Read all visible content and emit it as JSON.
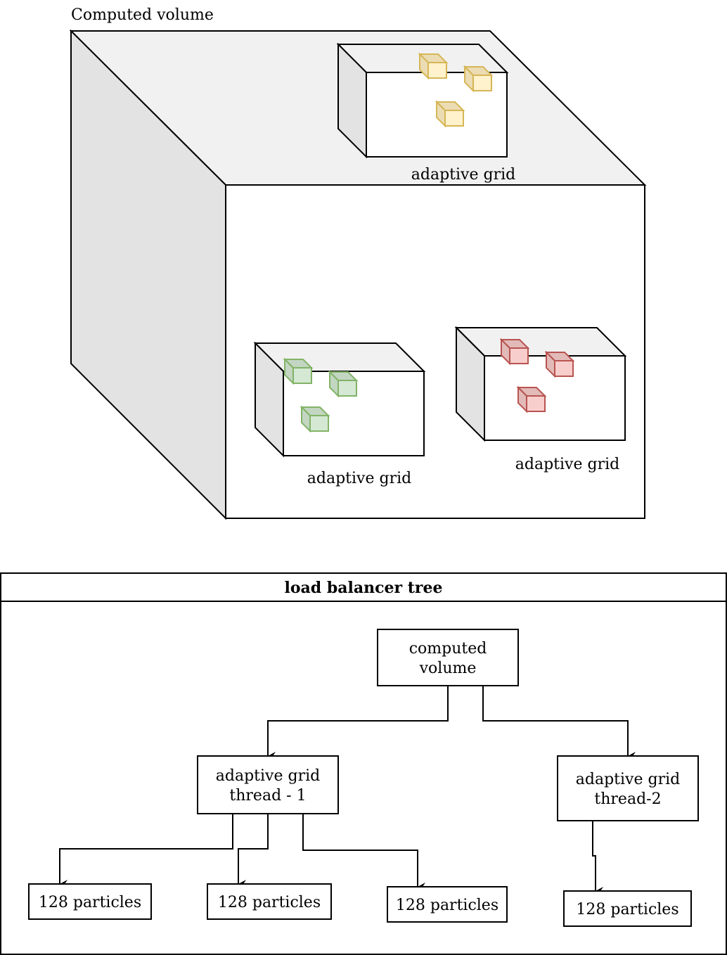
{
  "volume": {
    "label": "Computed volume",
    "colors": {
      "top": "#f1f1f1",
      "side": "#e3e3e3",
      "front": "#ffffff",
      "stroke": "#000000"
    },
    "grids": [
      {
        "id": "grid-top",
        "label": "adaptive grid",
        "particle_color": {
          "fill": "#fff2cc",
          "shade": "#ebdcb3",
          "stroke": "#d6b656"
        },
        "particles": 3
      },
      {
        "id": "grid-bottom-left",
        "label": "adaptive grid",
        "particle_color": {
          "fill": "#d5e8d4",
          "shade": "#c3d6c2",
          "stroke": "#82b366"
        },
        "particles": 3
      },
      {
        "id": "grid-bottom-right",
        "label": "adaptive grid",
        "particle_color": {
          "fill": "#f8cecc",
          "shade": "#e2bab8",
          "stroke": "#b85450"
        },
        "particles": 3
      }
    ]
  },
  "tree": {
    "title": "load balancer tree",
    "nodes": {
      "root": [
        "computed",
        "volume"
      ],
      "thread1": [
        "adaptive grid",
        "thread - 1"
      ],
      "thread2": [
        "adaptive grid",
        "thread-2"
      ],
      "leaf1": [
        "128 particles"
      ],
      "leaf2": [
        "128 particles"
      ],
      "leaf3": [
        "128 particles"
      ],
      "leaf4": [
        "128 particles"
      ]
    },
    "edges": [
      [
        "root",
        "thread1"
      ],
      [
        "root",
        "thread2"
      ],
      [
        "thread1",
        "leaf1"
      ],
      [
        "thread1",
        "leaf2"
      ],
      [
        "thread1",
        "leaf3"
      ],
      [
        "thread2",
        "leaf4"
      ]
    ]
  }
}
